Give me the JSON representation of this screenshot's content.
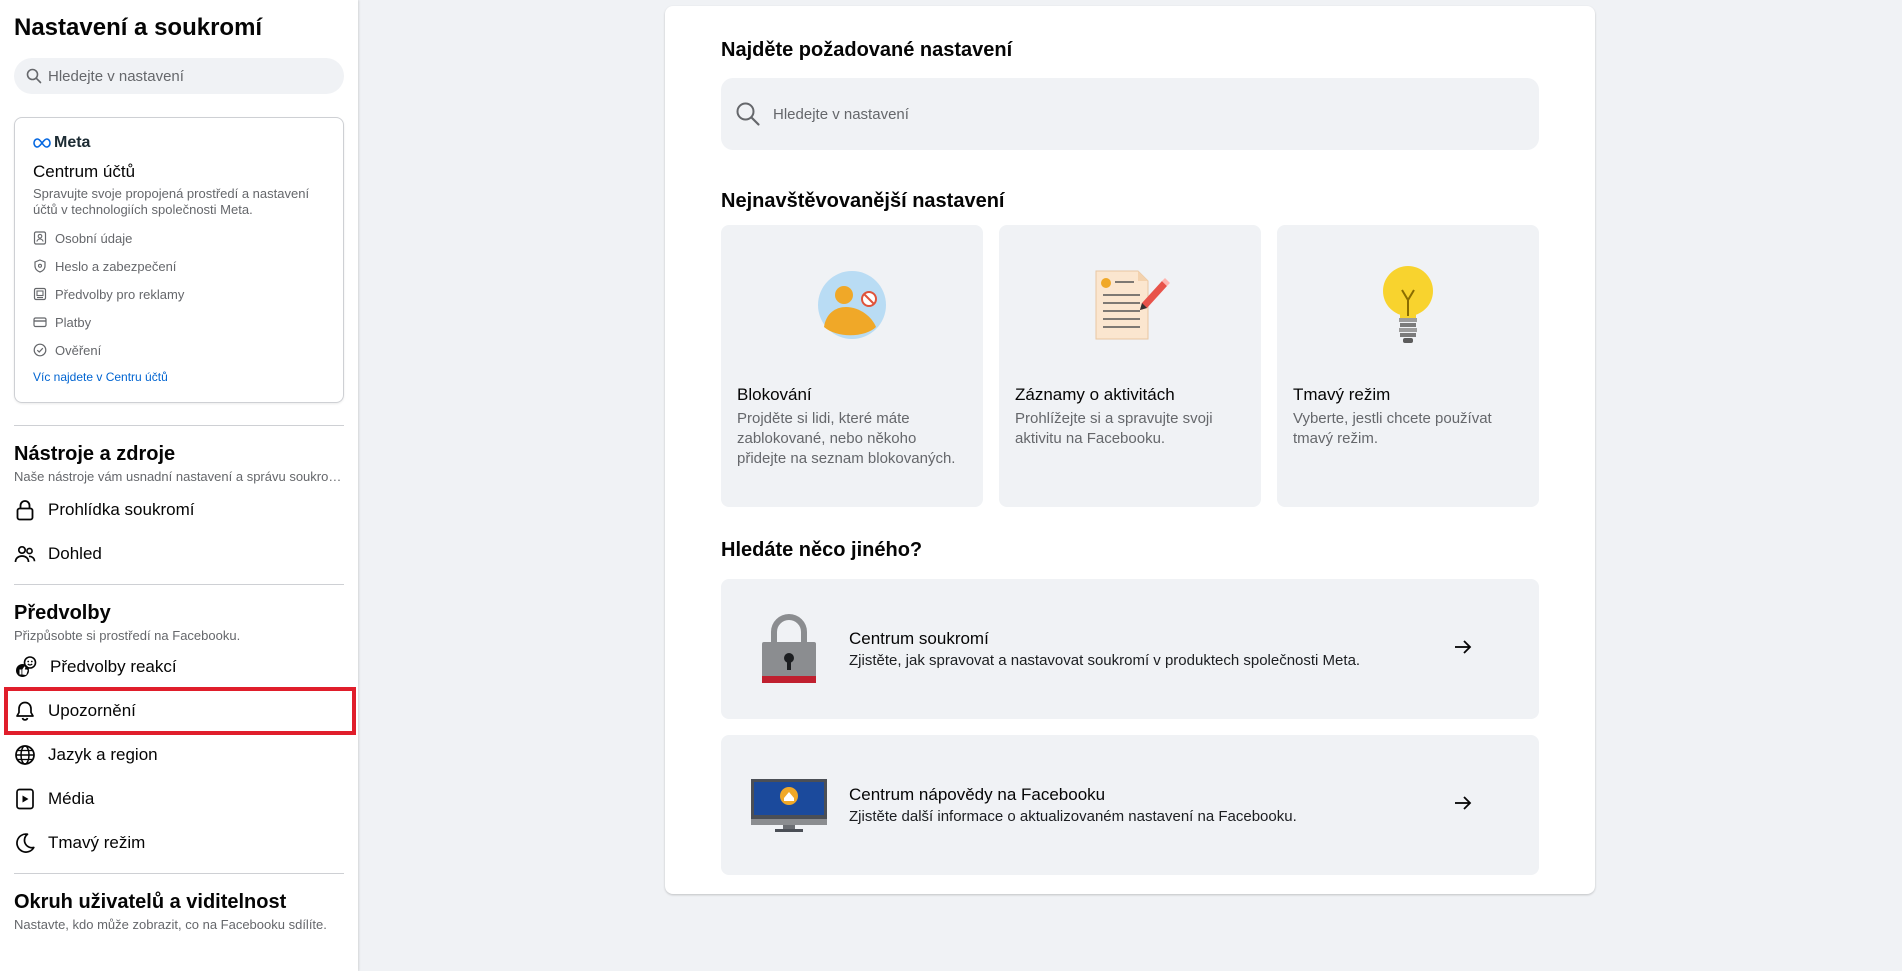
{
  "sidebar": {
    "title": "Nastavení a soukromí",
    "search_placeholder": "Hledejte v nastavení",
    "meta_card": {
      "brand": "Meta",
      "title": "Centrum účtů",
      "description": "Spravujte svoje propojená prostředí a nastavení účtů v technologiích společnosti Meta.",
      "items": [
        {
          "label": "Osobní údaje",
          "icon": "id-card-icon"
        },
        {
          "label": "Heslo a zabezpečení",
          "icon": "shield-icon"
        },
        {
          "label": "Předvolby pro reklamy",
          "icon": "ad-screen-icon"
        },
        {
          "label": "Platby",
          "icon": "credit-card-icon"
        },
        {
          "label": "Ověření",
          "icon": "check-badge-icon"
        }
      ],
      "link": "Víc najdete v Centru účtů"
    },
    "sections": [
      {
        "title": "Nástroje a zdroje",
        "description": "Naše nástroje vám usnadní nastavení a správu soukromí.",
        "items": [
          {
            "label": "Prohlídka soukromí",
            "icon": "lock-icon"
          },
          {
            "label": "Dohled",
            "icon": "people-icon"
          }
        ]
      },
      {
        "title": "Předvolby",
        "description": "Přizpůsobte si prostředí na Facebooku.",
        "items": [
          {
            "label": "Předvolby reakcí",
            "icon": "reactions-icon"
          },
          {
            "label": "Upozornění",
            "icon": "bell-icon"
          },
          {
            "label": "Jazyk a region",
            "icon": "globe-icon"
          },
          {
            "label": "Média",
            "icon": "media-icon"
          },
          {
            "label": "Tmavý režim",
            "icon": "moon-icon"
          }
        ]
      },
      {
        "title": "Okruh uživatelů a viditelnost",
        "description": "Nastavte, kdo může zobrazit, co na Facebooku sdílíte."
      }
    ]
  },
  "main": {
    "search_heading": "Najděte požadované nastavení",
    "search_placeholder": "Hledejte v nastavení",
    "popular_heading": "Nejnavštěvovanější nastavení",
    "cards": [
      {
        "title": "Blokování",
        "description": "Projděte si lidi, které máte zablokované, nebo někoho přidejte na seznam blokovaných.",
        "icon": "blocked-user-illustration"
      },
      {
        "title": "Záznamy o aktivitách",
        "description": "Prohlížejte si a spravujte svoji aktivitu na Facebooku.",
        "icon": "activity-log-illustration"
      },
      {
        "title": "Tmavý režim",
        "description": "Vyberte, jestli chcete používat tmavý režim.",
        "icon": "lightbulb-illustration"
      }
    ],
    "other_heading": "Hledáte něco jiného?",
    "links": [
      {
        "title": "Centrum soukromí",
        "description": "Zjistěte, jak spravovat a nastavovat soukromí v produktech společnosti Meta.",
        "icon": "padlock-illustration"
      },
      {
        "title": "Centrum nápovědy na Facebooku",
        "description": "Zjistěte další informace o aktualizovaném nastavení na Facebooku.",
        "icon": "monitor-illustration"
      }
    ]
  },
  "colors": {
    "accent_link": "#0064d1",
    "highlight_border": "#e01e2b",
    "page_bg": "#f0f2f5"
  }
}
